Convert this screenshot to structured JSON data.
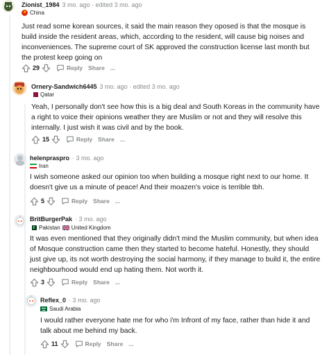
{
  "comments": [
    {
      "username": "Zionist_1984",
      "time": "3 mo. ago",
      "edited": "edited 3 mo. ago",
      "flair": "China",
      "body": "Just read some korean sources, it said the main reason they oposed is that the mosque is build inside the resident areas, which, according to the resident, will cause big noises and inconveniences. The supreme court of SK approved the construction license last month but the protest keep going on",
      "score": "29",
      "reply": "Reply",
      "share": "Share",
      "more": "..."
    },
    {
      "username": "Ornery-Sandwich6445",
      "time": "3 mo. ago",
      "edited": "edited 3 mo. ago",
      "flair": "Qatar",
      "body": "Yeah, I personally don't see how this is a big deal and South Koreas in the community have a right to voice their opinions weather they are Muslim or not and they will resolve this internally. I just wish it was civil and by the book.",
      "score": "15",
      "reply": "Reply",
      "share": "Share",
      "more": "..."
    },
    {
      "username": "helenpraspro",
      "time": "3 mo. ago",
      "flair": "Iran",
      "body": "I wish someone asked our opinion too when building a mosque right next to our home. It doesn't give us a minute of peace! And their moazen's voice is terrible tbh.",
      "score": "5",
      "reply": "Reply",
      "share": "Share",
      "more": "..."
    },
    {
      "username": "BritBurgerPak",
      "time": "3 mo. ago",
      "flair_1": "Pakistan",
      "flair_2": "United Kingdom",
      "body": "It was even mentioned that they originally didn't mind the Muslim community, but when idea of Mosque construction came then they started to become hateful. Honestly, they should just give up, its not worth destroying the social harmony, if they manage to build it, the entire neighbourhood would end up hating them. Not worth it.",
      "score": "3",
      "reply": "Reply",
      "share": "Share",
      "more": "..."
    },
    {
      "username": "Reflex_0",
      "time": "3 mo. ago",
      "flair": "Saudi Arabia",
      "body": "I would rather everyone hate me for who i'm Infront of my face, rather than hide it and talk about me behind my back.",
      "score": "11",
      "reply": "Reply",
      "share": "Share",
      "more": "..."
    }
  ],
  "colors": {
    "meta": "#878a8c",
    "text": "#1c1c1c",
    "thread": "#edeff1",
    "china_red": "#de2910",
    "qatar_maroon": "#8a1538",
    "iran_green": "#239f40",
    "iran_red": "#da0000",
    "pakistan_green": "#01411c",
    "uk_blue": "#012169",
    "saudi_green": "#006c35"
  },
  "icons": [
    "upvote-icon",
    "downvote-icon",
    "reply-icon",
    "share-icon",
    "more-icon",
    "avatar-icon"
  ]
}
